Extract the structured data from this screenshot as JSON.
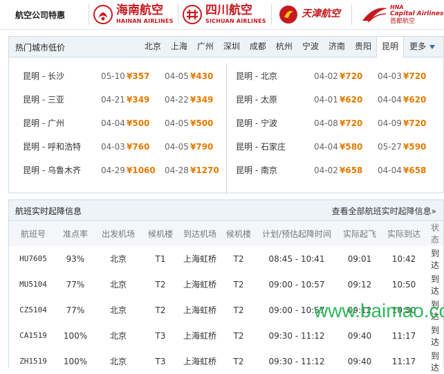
{
  "airline_bar": {
    "title": "航空公司特惠",
    "airlines": [
      {
        "cn": "海南航空",
        "en": "HAINAN AIRLINES",
        "color": "#c6191f"
      },
      {
        "cn": "四川航空",
        "en": "SICHUAN AIRLINES",
        "color": "#c6191f"
      },
      {
        "cn": "天津航空",
        "en": "",
        "color": "#c6191f"
      },
      {
        "cn": "首都航空",
        "en": "Capital Airlines",
        "color": "#c6191f"
      }
    ],
    "capital_hna": "HNA"
  },
  "fares": {
    "title": "热门城市低价",
    "cities": [
      "北京",
      "上海",
      "广州",
      "深圳",
      "成都",
      "杭州",
      "宁波",
      "济南",
      "贵阳",
      "昆明"
    ],
    "active_city": "昆明",
    "more_label": "更多",
    "left": [
      {
        "route": "昆明 - 长沙",
        "d1": "05-10",
        "p1": "¥357",
        "d2": "04-05",
        "p2": "¥430"
      },
      {
        "route": "昆明 - 三亚",
        "d1": "04-21",
        "p1": "¥349",
        "d2": "04-22",
        "p2": "¥349"
      },
      {
        "route": "昆明 - 广州",
        "d1": "04-04",
        "p1": "¥500",
        "d2": "04-05",
        "p2": "¥500"
      },
      {
        "route": "昆明 - 呼和浩特",
        "d1": "04-03",
        "p1": "¥760",
        "d2": "04-05",
        "p2": "¥790"
      },
      {
        "route": "昆明 - 乌鲁木齐",
        "d1": "04-29",
        "p1": "¥1060",
        "d2": "04-28",
        "p2": "¥1270"
      }
    ],
    "right": [
      {
        "route": "昆明 - 北京",
        "d1": "04-02",
        "p1": "¥720",
        "d2": "04-03",
        "p2": "¥720"
      },
      {
        "route": "昆明 - 太原",
        "d1": "04-01",
        "p1": "¥620",
        "d2": "04-04",
        "p2": "¥620"
      },
      {
        "route": "昆明 - 宁波",
        "d1": "04-08",
        "p1": "¥720",
        "d2": "04-09",
        "p2": "¥720"
      },
      {
        "route": "昆明 - 石家庄",
        "d1": "04-04",
        "p1": "¥580",
        "d2": "05-27",
        "p2": "¥590"
      },
      {
        "route": "昆明 - 南京",
        "d1": "04-02",
        "p1": "¥658",
        "d2": "04-04",
        "p2": "¥658"
      }
    ]
  },
  "flights": {
    "title": "航班实时起降信息",
    "view_all": "查看全部航班实时起降信息»",
    "headers": [
      "航班号",
      "准点率",
      "出发机场",
      "候机楼",
      "到达机场",
      "候机楼",
      "计划/预估起降时间",
      "实际起飞",
      "实际到达",
      "状态"
    ],
    "rows": [
      [
        "HU7605",
        "93%",
        "北京",
        "T1",
        "上海虹桥",
        "T2",
        "08:45 - 10:41",
        "09:01",
        "10:42",
        "到达"
      ],
      [
        "MU5104",
        "77%",
        "北京",
        "T2",
        "上海虹桥",
        "T2",
        "09:00 - 10:57",
        "09:12",
        "10:50",
        "到达"
      ],
      [
        "CZ5104",
        "77%",
        "北京",
        "T2",
        "上海虹桥",
        "T2",
        "09:00 - 10:57",
        "09:12",
        "10:50",
        "到达"
      ],
      [
        "CA1519",
        "100%",
        "北京",
        "T3",
        "上海虹桥",
        "T2",
        "09:30 - 11:12",
        "09:40",
        "11:17",
        "到达"
      ],
      [
        "ZH1519",
        "100%",
        "北京",
        "T3",
        "上海虹桥",
        "T2",
        "09:30 - 11:12",
        "09:40",
        "11:17",
        "到达"
      ]
    ]
  },
  "watermark": "www.baimao.com"
}
